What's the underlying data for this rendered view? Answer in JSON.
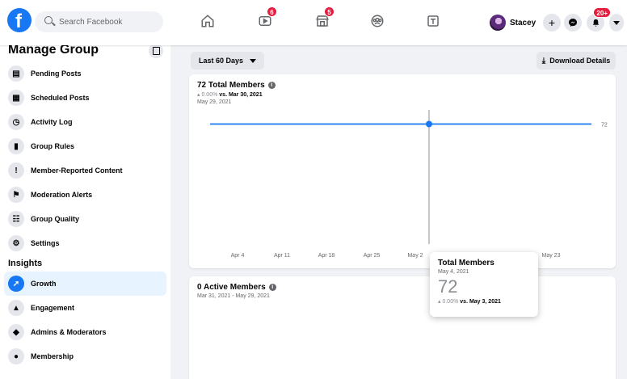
{
  "topbar": {
    "search_placeholder": "Search Facebook",
    "watch_badge": "6",
    "marketplace_badge": "5",
    "profile_name": "Stacey",
    "notifications_badge": "20+"
  },
  "sidebar": {
    "title": "Manage Group",
    "items": [
      {
        "label": "Pending Posts",
        "icon": "pending-posts-icon"
      },
      {
        "label": "Scheduled Posts",
        "icon": "calendar-icon"
      },
      {
        "label": "Activity Log",
        "icon": "clock-icon"
      },
      {
        "label": "Group Rules",
        "icon": "book-icon"
      },
      {
        "label": "Member-Reported Content",
        "icon": "report-icon"
      },
      {
        "label": "Moderation Alerts",
        "icon": "alert-icon"
      },
      {
        "label": "Group Quality",
        "icon": "clipboard-icon"
      },
      {
        "label": "Settings",
        "icon": "gear-icon"
      }
    ],
    "insights_label": "Insights",
    "insights_items": [
      {
        "label": "Growth",
        "icon": "growth-icon"
      },
      {
        "label": "Engagement",
        "icon": "thumbs-up-icon"
      },
      {
        "label": "Admins & Moderators",
        "icon": "shield-icon"
      },
      {
        "label": "Membership",
        "icon": "people-icon"
      }
    ]
  },
  "main": {
    "range_filter": "Last 60 Days",
    "download_label": "Download Details",
    "total_card": {
      "title": "72 Total Members",
      "change": "0.00%",
      "vs_label": "vs. Mar 30, 2021",
      "date": "May 29, 2021"
    },
    "active_card": {
      "title": "0 Active Members",
      "range": "Mar 31, 2021 - May 29, 2021"
    },
    "tooltip": {
      "title": "Total Members",
      "date": "May 4, 2021",
      "value": "72",
      "change": "0.00%",
      "vs_label": "vs. May 3, 2021"
    }
  },
  "colors": {
    "accent": "#1877f2",
    "badge": "#e41e3f",
    "background": "#f0f2f5"
  },
  "chart_data": {
    "type": "line",
    "x_tick_labels": [
      "Apr 4",
      "Apr 11",
      "Apr 18",
      "Apr 25",
      "May 2",
      "May 23"
    ],
    "series": [
      {
        "values": [
          72,
          72,
          72,
          72,
          72,
          72,
          72,
          72,
          72
        ]
      }
    ],
    "end_label": "72",
    "highlight": {
      "x": "May 4",
      "y": 72
    }
  }
}
